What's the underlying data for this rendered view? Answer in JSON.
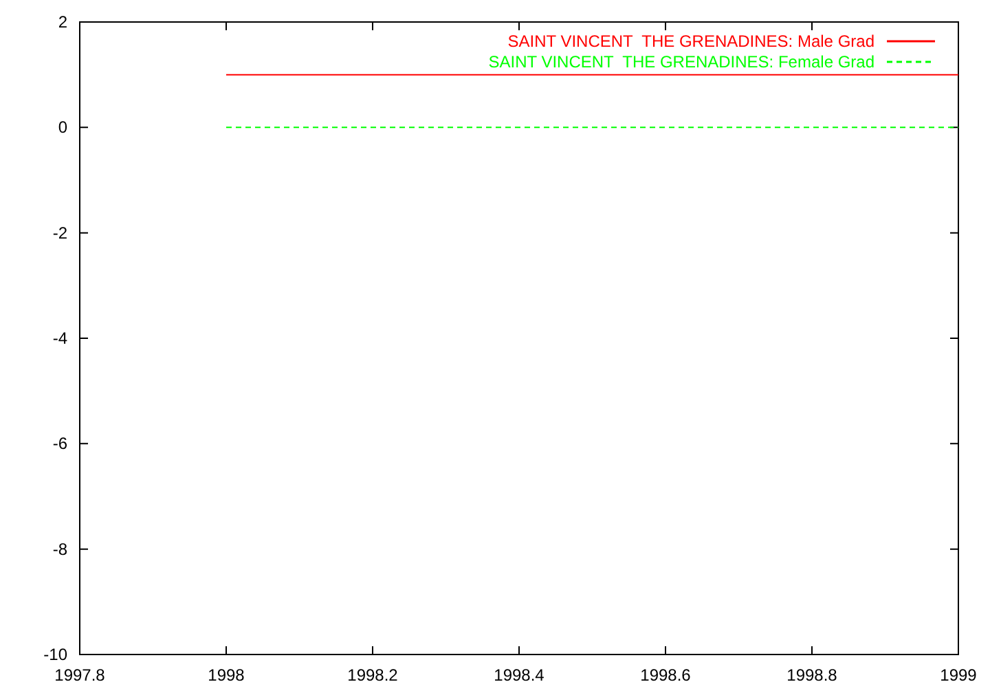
{
  "chart_data": {
    "type": "line",
    "x": [
      1998,
      1999
    ],
    "xlim": [
      1997.8,
      1999
    ],
    "ylim": [
      -10,
      2
    ],
    "xticks": [
      1997.8,
      1998,
      1998.2,
      1998.4,
      1998.6,
      1998.8,
      1999
    ],
    "yticks": [
      -10,
      -8,
      -6,
      -4,
      -2,
      0,
      2
    ],
    "legend": true,
    "series": [
      {
        "name": "SAINT VINCENT  THE GRENADINES: Male Grad",
        "color": "#ff0000",
        "line_style": "solid",
        "values": [
          1,
          1
        ]
      },
      {
        "name": "SAINT VINCENT  THE GRENADINES: Female Grad",
        "color": "#00ff00",
        "line_style": "dashed",
        "values": [
          0,
          0
        ]
      }
    ]
  }
}
